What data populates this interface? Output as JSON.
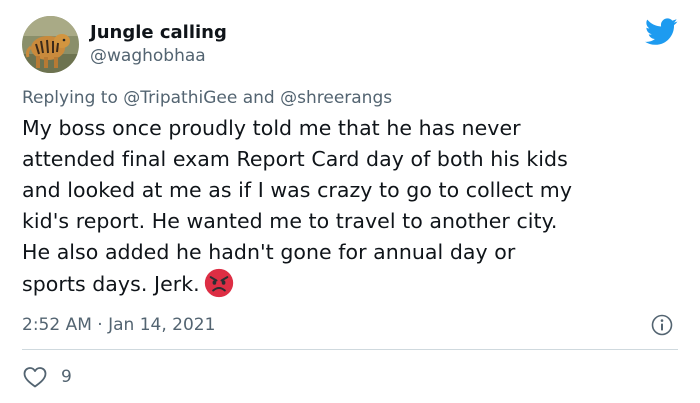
{
  "user": {
    "display_name": "Jungle calling",
    "handle": "@waghobhaa",
    "avatar_icon": "tiger-avatar-icon"
  },
  "header": {
    "brand_icon": "twitter-bird-icon",
    "brand_color": "#1d9bf0"
  },
  "reply": {
    "prefix": "Replying to",
    "mention_1": "@TripathiGee",
    "conjunction": "and",
    "mention_2": "@shreerangs"
  },
  "tweet": {
    "lines": [
      "My boss once proudly told me that he has never",
      "attended final exam Report Card day of both his kids",
      "and looked at me as if I was crazy to go to collect my",
      "kid's report. He wanted me to travel to another city.",
      "He also added he hadn't gone for annual day or",
      "sports days. Jerk."
    ],
    "emoji_icon": "angry-face-emoji-icon"
  },
  "meta": {
    "time": "2:52 AM",
    "separator": "·",
    "date": "Jan 14, 2021",
    "info_icon": "info-icon"
  },
  "engagement": {
    "like_icon": "heart-icon",
    "like_count": "9"
  },
  "colors": {
    "text_primary": "#0f1419",
    "text_secondary": "#536471",
    "divider": "#cfd9de"
  }
}
